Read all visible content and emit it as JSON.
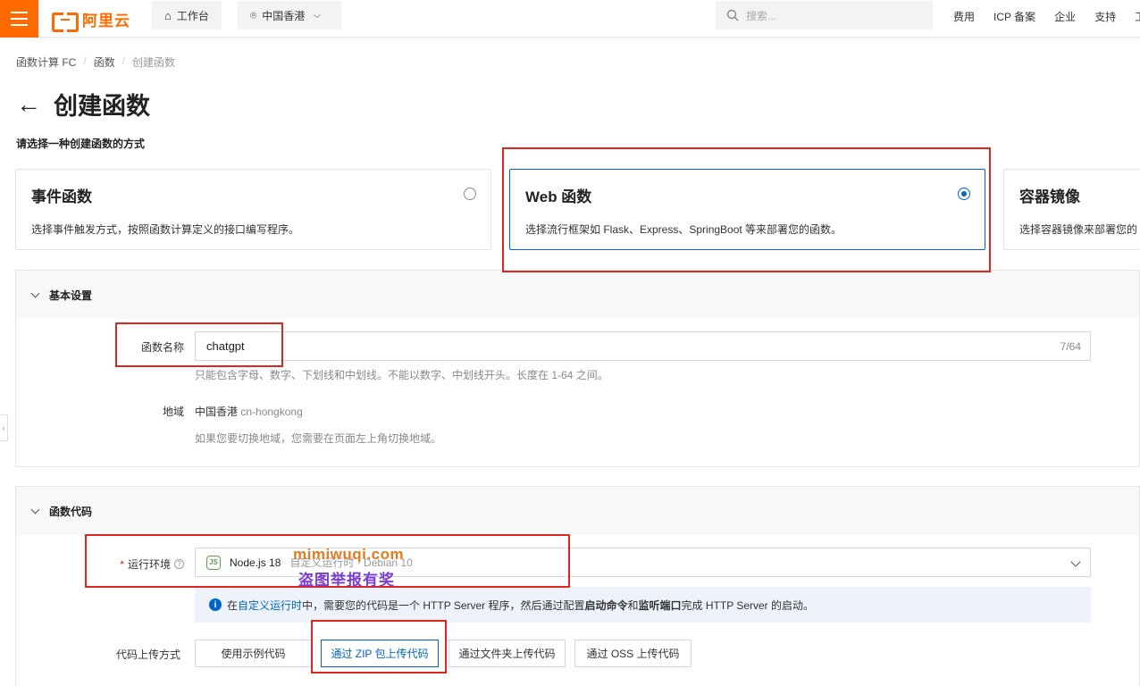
{
  "topbar": {
    "logo_text": "阿里云",
    "workbench": "工作台",
    "region": "中国香港",
    "search_placeholder": "搜索...",
    "links": [
      "费用",
      "ICP 备案",
      "企业",
      "支持",
      "工"
    ]
  },
  "breadcrumb": [
    "函数计算 FC",
    "函数",
    "创建函数"
  ],
  "page": {
    "title": "创建函数",
    "subtitle": "请选择一种创建函数的方式"
  },
  "types": [
    {
      "title": "事件函数",
      "desc": "选择事件触发方式，按照函数计算定义的接口编写程序。",
      "selected": false
    },
    {
      "title": "Web 函数",
      "desc": "选择流行框架如 Flask、Express、SpringBoot 等来部署您的函数。",
      "selected": true
    },
    {
      "title": "容器镜像",
      "desc": "选择容器镜像来部署您的",
      "selected": false
    }
  ],
  "basic": {
    "section_title": "基本设置",
    "name_label": "函数名称",
    "name_value": "chatgpt",
    "name_count": "7/64",
    "name_hint": "只能包含字母、数字、下划线和中划线。不能以数字、中划线开头。长度在 1-64 之间。",
    "region_label": "地域",
    "region_value": "中国香港",
    "region_code": "cn-hongkong",
    "region_hint": "如果您要切换地域，您需要在页面左上角切换地域。"
  },
  "code": {
    "section_title": "函数代码",
    "required_mark": "*",
    "runtime_label": "运行环境",
    "runtime_value": "Node.js 18",
    "runtime_extra": "自定义运行时 · Debian 10",
    "runtime_icon": "JS",
    "info_prefix": "在",
    "info_link": "自定义运行时",
    "info_mid": "中，需要您的代码是一个 HTTP Server 程序，然后通过配置",
    "info_bold1": "启动命令",
    "info_and": "和",
    "info_bold2": "监听端口",
    "info_suffix": "完成 HTTP Server 的启动。",
    "upload_label": "代码上传方式",
    "upload_options": [
      "使用示例代码",
      "通过 ZIP 包上传代码",
      "通过文件夹上传代码",
      "通过 OSS 上传代码"
    ],
    "upload_selected": 1
  },
  "watermark": {
    "line1": "mimiwuqi.com",
    "line2": "盗图举报有奖"
  },
  "colors": {
    "brand": "#ff6a00",
    "primary": "#0064c8",
    "highlight": "#e0261c"
  }
}
